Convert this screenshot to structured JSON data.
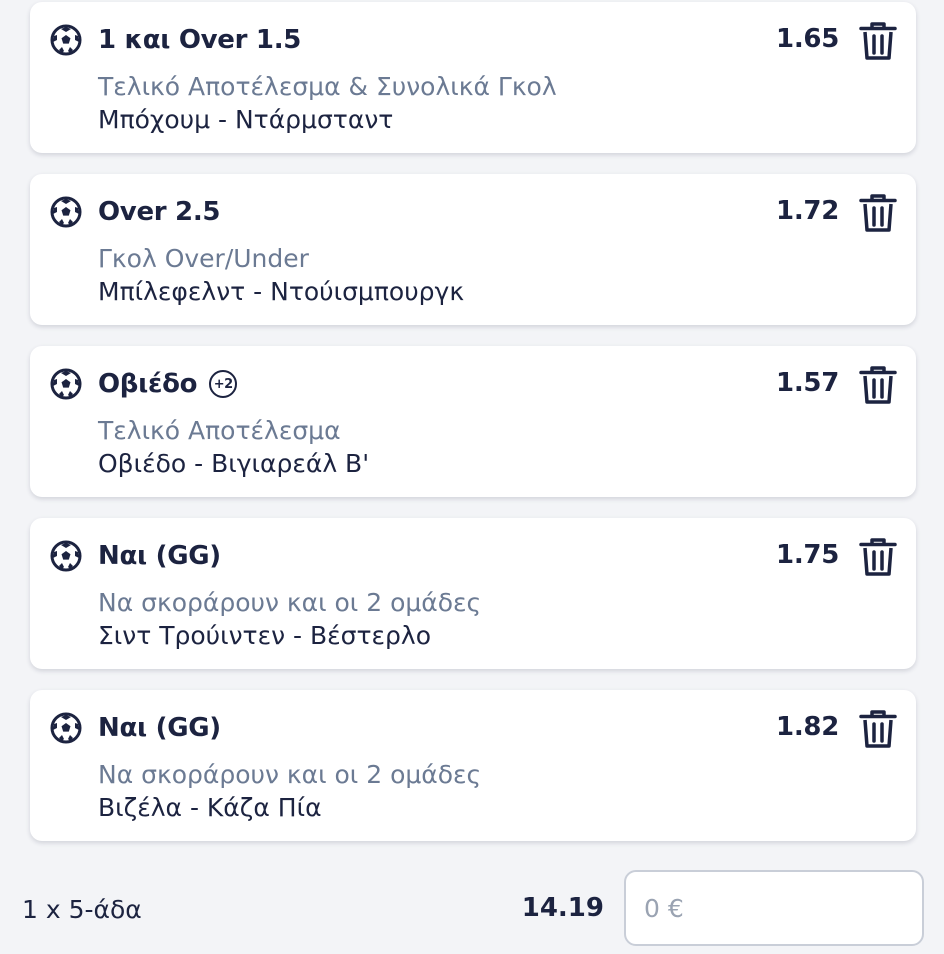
{
  "bets": [
    {
      "selection": "1 και Over 1.5",
      "market": "Τελικό Αποτέλεσμα & Συνολικά Γκολ",
      "match": "Μπόχουμ - Ντάρμσταντ",
      "odds": "1.65",
      "badge": ""
    },
    {
      "selection": "Over 2.5",
      "market": "Γκολ Over/Under",
      "match": "Μπίλεφελντ - Ντούισμπουργκ",
      "odds": "1.72",
      "badge": ""
    },
    {
      "selection": "Οβιέδο",
      "market": "Τελικό Αποτέλεσμα",
      "match": "Οβιέδο - Βιγιαρεάλ Β'",
      "odds": "1.57",
      "badge": "+2"
    },
    {
      "selection": "Ναι (GG)",
      "market": "Να σκοράρουν και οι 2 ομάδες",
      "match": "Σιντ Τρούιντεν - Βέστερλο",
      "odds": "1.75",
      "badge": ""
    },
    {
      "selection": "Ναι (GG)",
      "market": "Να σκοράρουν και οι 2 ομάδες",
      "match": "Βιζέλα - Κάζα Πία",
      "odds": "1.82",
      "badge": ""
    }
  ],
  "footer": {
    "system_label": "1 x 5-άδα",
    "total_odds": "14.19",
    "stake_placeholder": "0 €",
    "stake_value": ""
  },
  "icons": {
    "sport": "soccer-ball-icon",
    "delete": "trash-icon"
  },
  "colors": {
    "primary_text": "#1c2340",
    "secondary_text": "#6b7a93",
    "card_background": "#ffffff",
    "page_background": "#f3f4f7"
  }
}
